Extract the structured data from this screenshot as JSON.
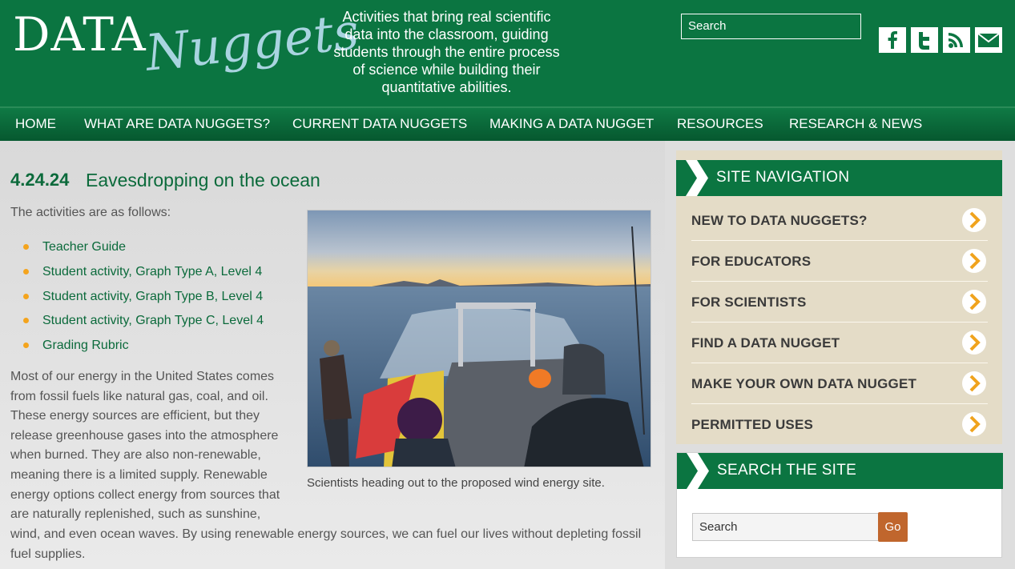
{
  "header": {
    "logo_word1": "DATA",
    "logo_word2": "Nuggets",
    "tagline": "Activities that bring real scientific data into the classroom, guiding students through the entire process of science while building their quantitative abilities.",
    "search_placeholder": "Search",
    "social": [
      {
        "icon": "facebook-icon"
      },
      {
        "icon": "twitter-icon"
      },
      {
        "icon": "rss-icon"
      },
      {
        "icon": "email-icon"
      }
    ]
  },
  "nav": [
    "HOME",
    "WHAT ARE DATA NUGGETS?",
    "CURRENT DATA NUGGETS",
    "MAKING A DATA NUGGET",
    "RESOURCES",
    "RESEARCH & NEWS"
  ],
  "post": {
    "date": "4.24.24",
    "title": "Eavesdropping on the ocean",
    "intro": "The activities are as follows:",
    "activities": [
      "Teacher Guide",
      "Student activity, Graph Type A, Level 4",
      "Student activity, Graph Type B, Level 4",
      "Student activity, Graph Type C, Level 4",
      "Grading Rubric"
    ],
    "body": "Most of our energy in the United States comes from fossil fuels like natural gas, coal, and oil. These energy sources are efficient, but they release greenhouse gases into the atmosphere when burned. They are also non-renewable, meaning there is a limited supply. Renewable energy options collect energy from sources that are naturally replenished, such as sunshine,",
    "body_cont": "wind, and even ocean waves. By using renewable energy sources, we can fuel our lives without depleting fossil fuel supplies.",
    "image_caption": "Scientists heading out to the proposed wind energy site."
  },
  "sidebar": {
    "nav_title": "SITE NAVIGATION",
    "items": [
      "NEW TO DATA NUGGETS?",
      "FOR EDUCATORS",
      "FOR SCIENTISTS",
      "FIND A DATA NUGGET",
      "MAKE YOUR OWN DATA NUGGET",
      "PERMITTED USES"
    ],
    "search_title": "SEARCH THE SITE",
    "search_placeholder": "Search",
    "go_label": "Go"
  },
  "colors": {
    "brand_green": "#0b7541",
    "link_green": "#0b6a3b",
    "accent_orange": "#f4a41d",
    "sidebar_tan": "#e4dcc7",
    "go_button": "#c0662d"
  }
}
